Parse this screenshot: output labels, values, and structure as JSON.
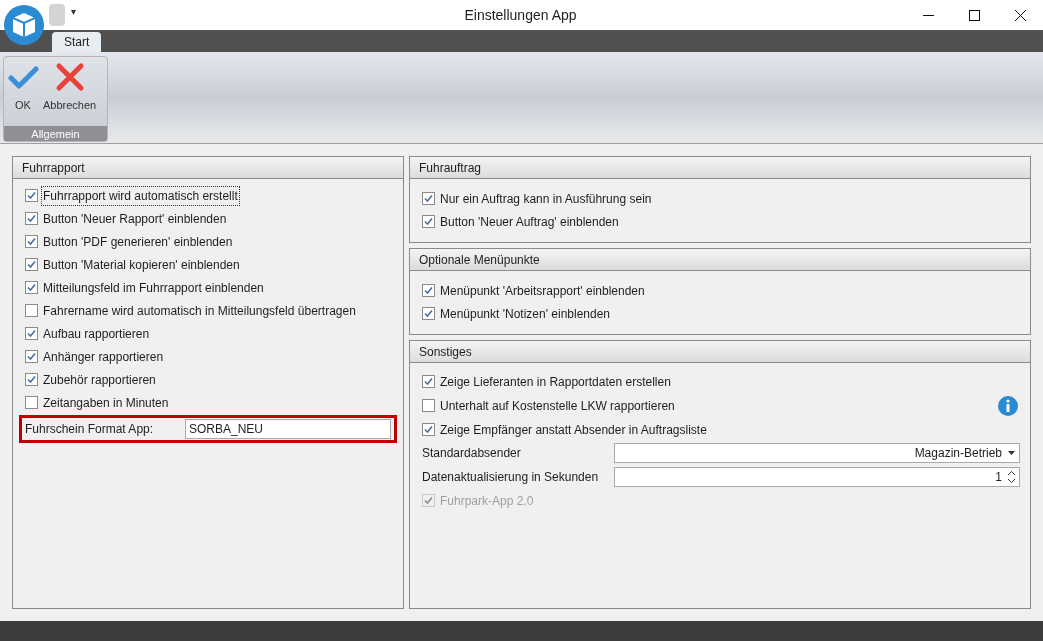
{
  "window": {
    "title": "Einstellungen App",
    "menu_glyph": "▾"
  },
  "ribbon": {
    "tabs": [
      {
        "label": "Start",
        "selected": true
      }
    ],
    "buttons": [
      {
        "kind": "ok",
        "label": "OK"
      },
      {
        "kind": "cancel",
        "label": "Abbrechen"
      }
    ],
    "group": "Allgemein"
  },
  "fuhrrapport": {
    "title": "Fuhrrapport",
    "items": [
      {
        "label": "Fuhrrapport wird automatisch erstellt",
        "checked": true,
        "focused": true
      },
      {
        "label": "Button 'Neuer Rapport' einblenden",
        "checked": true,
        "focused": false
      },
      {
        "label": "Button 'PDF generieren' einblenden",
        "checked": true,
        "focused": false
      },
      {
        "label": "Button 'Material kopieren' einblenden",
        "checked": true,
        "focused": false
      },
      {
        "label": "Mitteilungsfeld im Fuhrrapport einblenden",
        "checked": true,
        "focused": false
      },
      {
        "label": "Fahrername wird automatisch in Mitteilungsfeld übertragen",
        "checked": false,
        "focused": false
      },
      {
        "label": "Aufbau rapportieren",
        "checked": true,
        "focused": false
      },
      {
        "label": "Anhänger rapportieren",
        "checked": true,
        "focused": false
      },
      {
        "label": "Zubehör rapportieren",
        "checked": true,
        "focused": false
      },
      {
        "label": "Zeitangaben in Minuten",
        "checked": false,
        "focused": false
      }
    ],
    "field": {
      "label": "Fuhrschein Format App:",
      "value": "SORBA_NEU",
      "highlighted": true
    }
  },
  "fuhrauftrag": {
    "title": "Fuhrauftrag",
    "items": [
      {
        "label": "Nur ein Auftrag kann in Ausführung sein",
        "checked": true
      },
      {
        "label": "Button 'Neuer Auftrag' einblenden",
        "checked": true
      }
    ]
  },
  "optionale_menuepunkte": {
    "title": "Optionale Menüpunkte",
    "items": [
      {
        "label": "Menüpunkt 'Arbeitsrapport' einblenden",
        "checked": true
      },
      {
        "label": "Menüpunkt 'Notizen' einblenden",
        "checked": true
      }
    ]
  },
  "sonstiges": {
    "title": "Sonstiges",
    "items": [
      {
        "kind": "checkbox",
        "label": "Zeige Lieferanten in Rapportdaten erstellen",
        "checked": true,
        "disabled": false,
        "info": false
      },
      {
        "kind": "checkbox",
        "label": "Unterhalt auf Kostenstelle LKW rapportieren",
        "checked": false,
        "disabled": false,
        "info": true
      },
      {
        "kind": "checkbox",
        "label": "Zeige Empfänger anstatt Absender in Auftragsliste",
        "checked": true,
        "disabled": false,
        "info": false
      },
      {
        "kind": "dropdown",
        "label": "Standardabsender",
        "value": "Magazin-Betrieb"
      },
      {
        "kind": "spinner",
        "label": "Datenaktualisierung in Sekunden",
        "value": "1"
      },
      {
        "kind": "checkbox",
        "label": "Fuhrpark-App 2.0",
        "checked": true,
        "disabled": true,
        "info": false
      }
    ]
  }
}
